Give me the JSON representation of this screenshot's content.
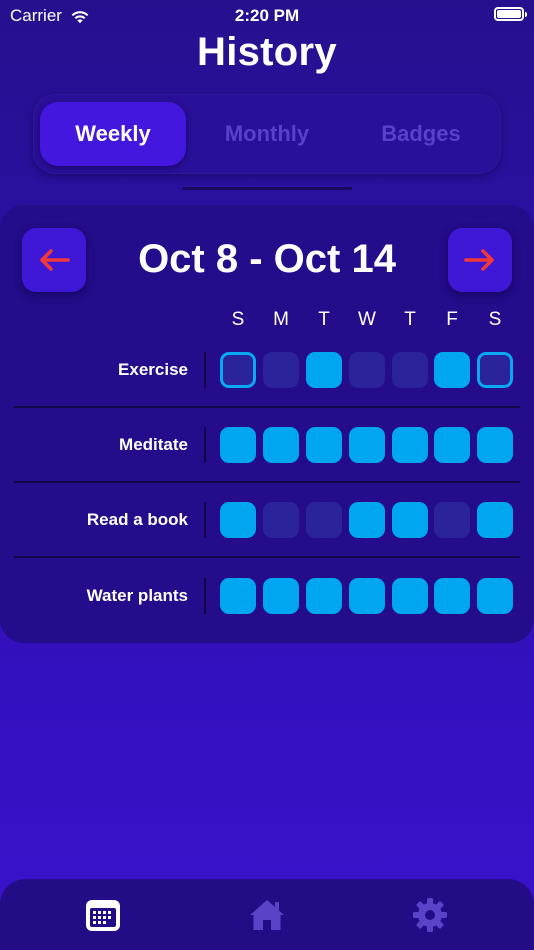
{
  "status_bar": {
    "carrier": "Carrier",
    "time": "2:20 PM"
  },
  "page": {
    "title": "History"
  },
  "tabs": {
    "segments": [
      {
        "label": "Weekly",
        "selected": true
      },
      {
        "label": "Monthly",
        "selected": false
      },
      {
        "label": "Badges",
        "selected": false
      }
    ]
  },
  "history": {
    "week_range": "Oct 8 - Oct 14",
    "days": [
      "S",
      "M",
      "T",
      "W",
      "T",
      "F",
      "S"
    ],
    "habits": [
      {
        "name": "Exercise",
        "days": [
          "today",
          "missed",
          "done",
          "missed",
          "missed",
          "done",
          "today"
        ]
      },
      {
        "name": "Meditate",
        "days": [
          "done",
          "done",
          "done",
          "done",
          "done",
          "done",
          "done"
        ]
      },
      {
        "name": "Read a book",
        "days": [
          "done",
          "missed",
          "missed",
          "done",
          "done",
          "missed",
          "done"
        ]
      },
      {
        "name": "Water plants",
        "days": [
          "done",
          "done",
          "done",
          "done",
          "done",
          "done",
          "done"
        ]
      }
    ]
  },
  "colors": {
    "background_top": "#26108e",
    "background_bottom": "#3a12cc",
    "card": "#240c8a",
    "active_segment": "#4317dd",
    "inactive_segment_text": "#5941c9",
    "nav_arrow": "#f03a3a",
    "done": "#00a6ef",
    "missed": "#2a2399",
    "today_outline": "#0aa8f0",
    "tab_active_icon": "#ffffff",
    "tab_inactive_icon": "#5b43c8"
  },
  "icons": {
    "wifi": "wifi-icon",
    "battery": "battery-icon",
    "prev": "arrow-left-icon",
    "next": "arrow-right-icon",
    "tab_history": "calendar-icon",
    "tab_home": "house-icon",
    "tab_settings": "gear-icon"
  },
  "tab_bar": {
    "active": "history"
  }
}
